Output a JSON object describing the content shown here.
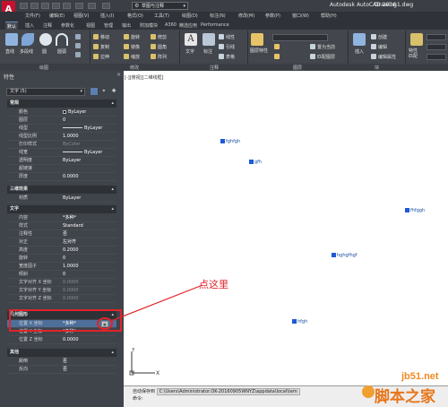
{
  "titlebar": {
    "app_logo": "A",
    "workspace": "草图与注释",
    "app_title": "Autodesk AutoCAD 2016",
    "doc_title": "Drawing1.dwg"
  },
  "menubar": {
    "items": [
      "文件(F)",
      "编辑(E)",
      "视图(V)",
      "插入(I)",
      "格式(O)",
      "工具(T)",
      "绘图(D)",
      "标注(N)",
      "修改(M)",
      "参数(P)",
      "窗口(W)",
      "帮助(H)"
    ]
  },
  "ribbon": {
    "tabs": [
      "默认",
      "插入",
      "注释",
      "参数化",
      "视图",
      "管理",
      "输出",
      "附加模块",
      "A360",
      "精选应用",
      "Performance"
    ],
    "active_tab": "默认",
    "draw_tools": [
      "直线",
      "多段线",
      "圆",
      "圆弧"
    ],
    "modify_tools": [
      "移动",
      "旋转",
      "修剪",
      "复制",
      "镜像",
      "圆角",
      "拉伸",
      "缩放",
      "阵列"
    ],
    "annotation_tools": [
      "文字",
      "标注",
      "线性",
      "引线",
      "表格"
    ],
    "layer_tools": [
      "图层特性",
      "置为当前",
      "匹配图层"
    ],
    "block_tools": [
      "插入",
      "创建",
      "编辑",
      "编辑属性"
    ],
    "properties_tools": [
      "特性匹配"
    ],
    "panel_titles": [
      "绘图",
      "修改",
      "注释",
      "图层",
      "块"
    ]
  },
  "palette": {
    "title": "特性",
    "close": "×",
    "selection": "文字 (5)",
    "sections": {
      "general": {
        "title": "常规",
        "rows": [
          {
            "name": "颜色",
            "value": "ByLayer"
          },
          {
            "name": "图层",
            "value": "0"
          },
          {
            "name": "线型",
            "value": "ByLayer"
          },
          {
            "name": "线型比例",
            "value": "1.0000"
          },
          {
            "name": "打印样式",
            "value": "ByColor"
          },
          {
            "name": "线宽",
            "value": "ByLayer"
          },
          {
            "name": "透明度",
            "value": "ByLayer"
          },
          {
            "name": "超链接",
            "value": ""
          },
          {
            "name": "厚度",
            "value": "0.0000"
          }
        ]
      },
      "3d": {
        "title": "三维效果",
        "rows": [
          {
            "name": "材质",
            "value": "ByLayer"
          }
        ]
      },
      "text": {
        "title": "文字",
        "rows": [
          {
            "name": "内容",
            "value": "*多种*"
          },
          {
            "name": "样式",
            "value": "Standard"
          },
          {
            "name": "注释性",
            "value": "否"
          },
          {
            "name": "对正",
            "value": "左对齐"
          },
          {
            "name": "高度",
            "value": "0.2000"
          },
          {
            "name": "旋转",
            "value": "0"
          },
          {
            "name": "宽度因子",
            "value": "1.0000"
          },
          {
            "name": "倾斜",
            "value": "0"
          },
          {
            "name": "文字对齐 X 坐标",
            "value": "0.0000"
          },
          {
            "name": "文字对齐 Y 坐标",
            "value": "0.0000"
          },
          {
            "name": "文字对齐 Z 坐标",
            "value": "0.0000"
          }
        ]
      },
      "geometry": {
        "title": "几何图形",
        "rows": [
          {
            "name": "位置 X 坐标",
            "value": "*多种*"
          },
          {
            "name": "位置 Y 坐标",
            "value": "*多种*"
          },
          {
            "name": "位置 Z 坐标",
            "value": "0.0000"
          }
        ]
      },
      "misc": {
        "title": "其他",
        "rows": [
          {
            "name": "颠倒",
            "value": "否"
          },
          {
            "name": "反向",
            "value": "否"
          }
        ]
      }
    }
  },
  "annotation": {
    "callout": "点这里"
  },
  "canvas": {
    "viewport_label": "[-][俯视][二维线框]",
    "text_objects": [
      "fghfgh",
      "gfh",
      "fhfggh",
      "hghgfhgf",
      "hfgh"
    ],
    "ucs_x": "X",
    "ucs_y": "Y"
  },
  "command": {
    "line1_prefix": "自动保存到",
    "line1_path": "C:\\Users\\Administrator.OK-20160905WNYZ\\appdata\\local\\tem",
    "line2": "命令:"
  },
  "watermark": {
    "site": "jb51.net",
    "name": "脚本之家"
  },
  "colors": {
    "accent_red": "#e0242b",
    "selection_blue": "#1e5ad6",
    "watermark_orange": "#e8761a"
  }
}
